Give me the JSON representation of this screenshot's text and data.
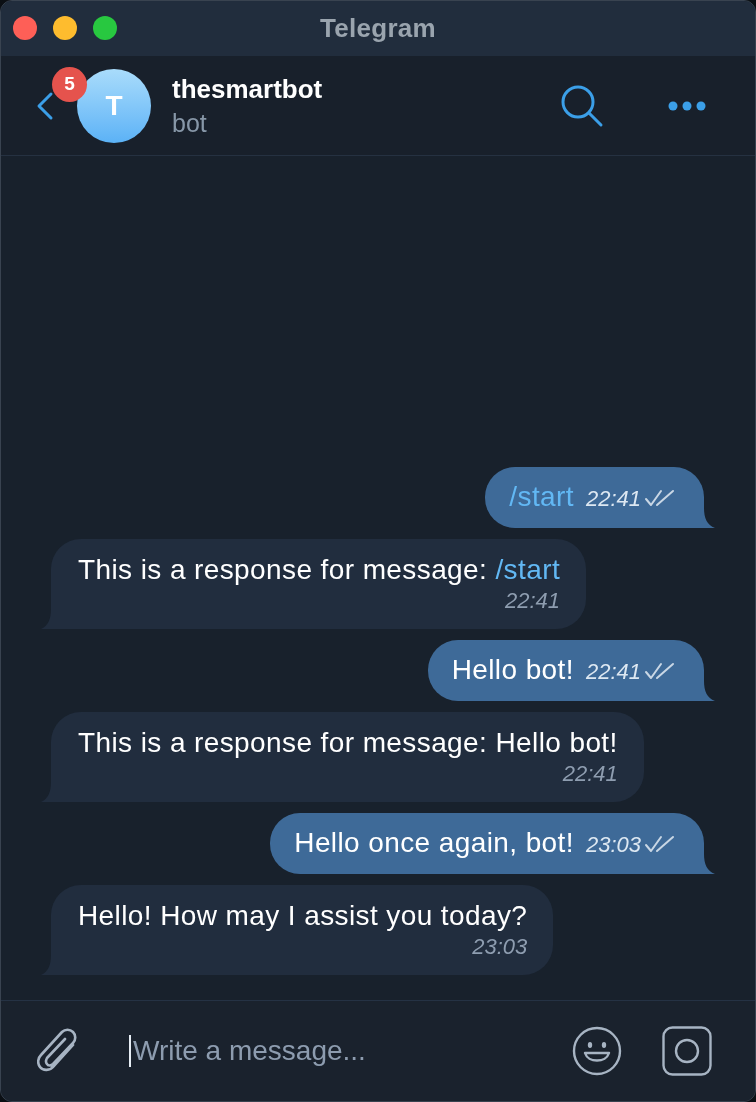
{
  "window": {
    "title": "Telegram"
  },
  "header": {
    "unread_count": "5",
    "avatar": {
      "letter": "T"
    },
    "name": "thesmartbot",
    "status": "bot"
  },
  "messages": [
    {
      "kind": "outgoing",
      "parts": [
        {
          "kind": "command",
          "text": "/start"
        }
      ],
      "time": "22:41",
      "read": true
    },
    {
      "kind": "incoming",
      "parts": [
        {
          "kind": "plain",
          "text": "This is a response for message: "
        },
        {
          "kind": "command",
          "text": "/start"
        }
      ],
      "time": "22:41"
    },
    {
      "kind": "outgoing",
      "parts": [
        {
          "kind": "plain",
          "text": "Hello bot!"
        }
      ],
      "time": "22:41",
      "read": true
    },
    {
      "kind": "incoming",
      "parts": [
        {
          "kind": "plain",
          "text": "This is a response for message: Hello bot!"
        }
      ],
      "time": "22:41"
    },
    {
      "kind": "outgoing",
      "parts": [
        {
          "kind": "plain",
          "text": "Hello once again, bot!"
        }
      ],
      "time": "23:03",
      "read": true
    },
    {
      "kind": "incoming",
      "parts": [
        {
          "kind": "plain",
          "text": "Hello! How may I assist you today?"
        }
      ],
      "time": "23:03"
    }
  ],
  "composer": {
    "placeholder": "Write a message...",
    "focused": true
  }
}
